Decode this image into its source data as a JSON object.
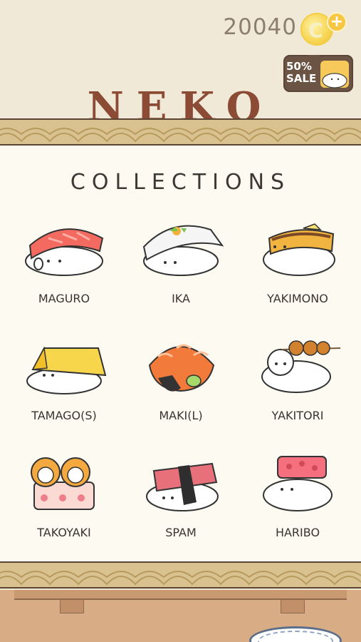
{
  "currency": {
    "amount": "20040",
    "coin_icon": "coin-icon",
    "add_icon": "plus-icon"
  },
  "sale_badge": {
    "line1": "50%",
    "line2": "SALE"
  },
  "header": {
    "title": "NEKO"
  },
  "collections": {
    "title": "COLLECTIONS",
    "items": [
      {
        "label": "MAGURO"
      },
      {
        "label": "IKA"
      },
      {
        "label": "YAKIMONO"
      },
      {
        "label": "TAMAGO(S)"
      },
      {
        "label": "MAKI(L)"
      },
      {
        "label": "YAKITORI"
      },
      {
        "label": "TAKOYAKI"
      },
      {
        "label": "SPAM"
      },
      {
        "label": "HARIBO"
      }
    ]
  },
  "colors": {
    "title_brown": "#8b4b34",
    "band_gold": "#d9c28f",
    "panel_cream": "#fdfaf2",
    "text_dark": "#3f3832"
  }
}
